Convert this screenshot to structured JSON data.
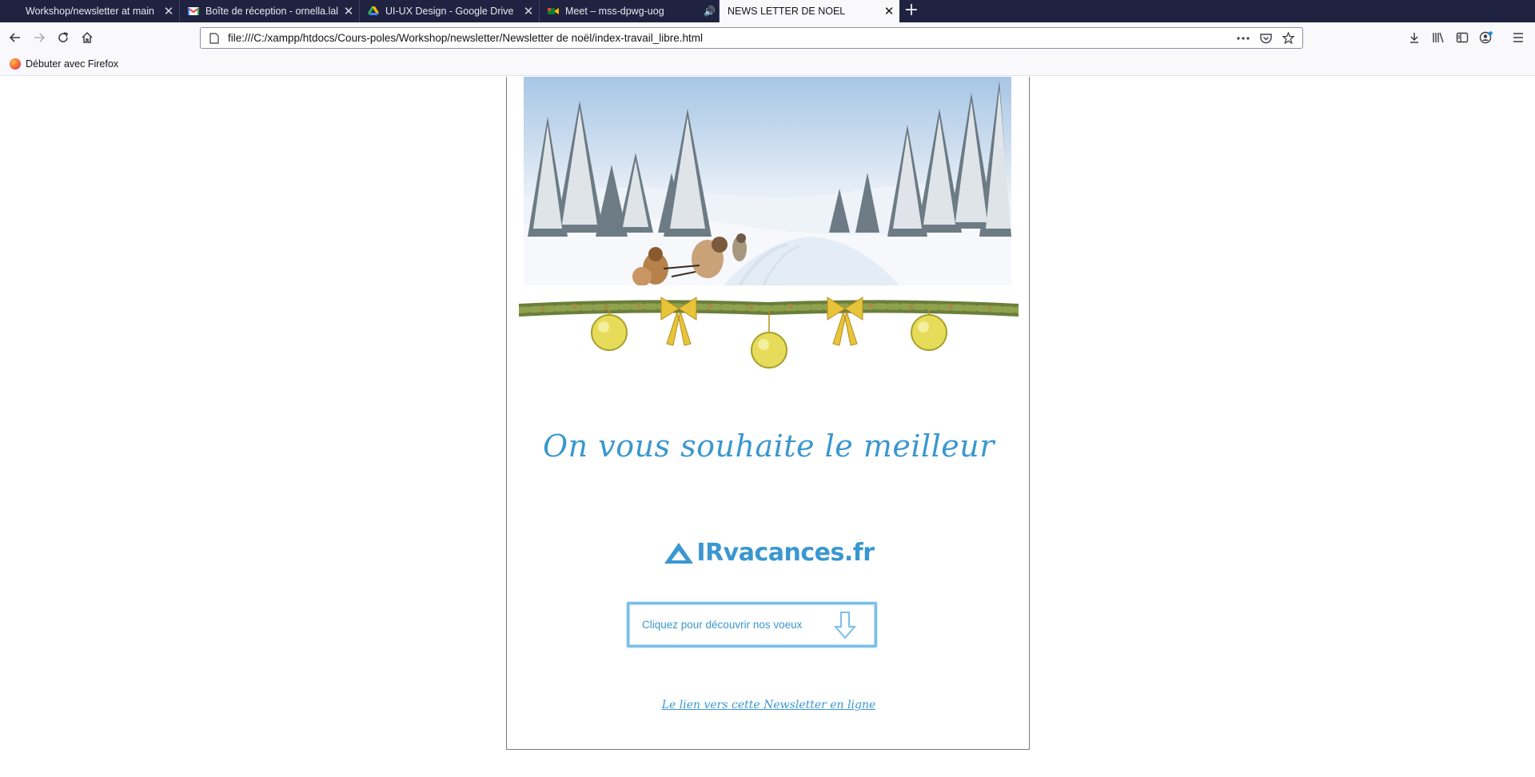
{
  "browser": {
    "tabs": [
      {
        "label": "Workshop/newsletter at main ·",
        "favicon_color": "#1f2341",
        "active": false
      },
      {
        "label": "Boîte de réception - ornella.lall",
        "favicon_color": "#ea4335",
        "active": false
      },
      {
        "label": "UI-UX Design - Google Drive",
        "favicon_color": "#34a853",
        "active": false
      },
      {
        "label": "Meet – mss-dpwg-uog",
        "favicon_color": "#00832d",
        "active": false
      },
      {
        "label": "NEWS LETTER DE NOEL",
        "favicon_color": "#f9f9fb",
        "active": true
      }
    ],
    "url": "file:///C:/xampp/htdocs/Cours-poles/Workshop/newsletter/Newsletter de noël/index-travail_libre.html",
    "bookmark": "Débuter avec Firefox"
  },
  "newsletter": {
    "headline": "On vous souhaite le meilleur",
    "brand_logo_text": "IRvacances.fr",
    "cta_label": "Cliquez pour découvrir nos voeux",
    "online_link": "Le lien vers cette Newsletter en ligne",
    "accent_color": "#3a97d0"
  }
}
